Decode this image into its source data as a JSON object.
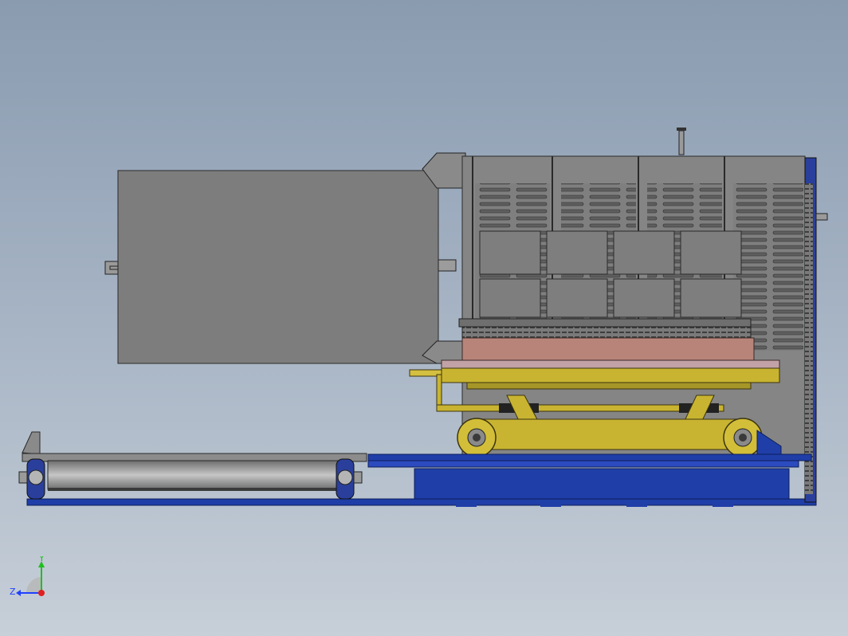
{
  "viewport": {
    "background_top": "#8a9bb0",
    "background_bottom": "#c7cfd8"
  },
  "triad": {
    "y_label": "Y",
    "z_label": "Z",
    "y_color": "#1fbf1f",
    "z_color": "#2040ff",
    "x_color": "#e02020"
  },
  "colors": {
    "housing_gray": "#858585",
    "door_gray": "#7d7d7d",
    "frame_blue": "#1f3ea8",
    "lift_yellow": "#c9b431",
    "refractory_pink": "#b8847a",
    "heater_red": "#b02a2a"
  },
  "icons": {
    "model": "furnace-assembly",
    "triad": "coordinate-triad-icon"
  }
}
